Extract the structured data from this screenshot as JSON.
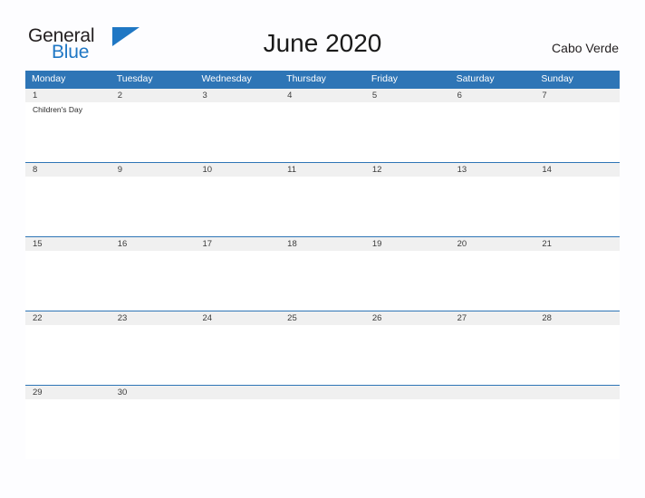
{
  "brand": {
    "name_part1": "General",
    "name_part2": "Blue",
    "flag_icon": "blue-triangle-flag-icon",
    "color_dark": "#231f20",
    "color_blue": "#1f77c4"
  },
  "header": {
    "title": "June 2020",
    "region": "Cabo Verde"
  },
  "calendar": {
    "accent_color": "#2e75b6",
    "band_color": "#f0f0f0",
    "weekdays": [
      "Monday",
      "Tuesday",
      "Wednesday",
      "Thursday",
      "Friday",
      "Saturday",
      "Sunday"
    ],
    "weeks": [
      {
        "days": [
          {
            "date": "1",
            "event": "Children's Day"
          },
          {
            "date": "2",
            "event": ""
          },
          {
            "date": "3",
            "event": ""
          },
          {
            "date": "4",
            "event": ""
          },
          {
            "date": "5",
            "event": ""
          },
          {
            "date": "6",
            "event": ""
          },
          {
            "date": "7",
            "event": ""
          }
        ]
      },
      {
        "days": [
          {
            "date": "8",
            "event": ""
          },
          {
            "date": "9",
            "event": ""
          },
          {
            "date": "10",
            "event": ""
          },
          {
            "date": "11",
            "event": ""
          },
          {
            "date": "12",
            "event": ""
          },
          {
            "date": "13",
            "event": ""
          },
          {
            "date": "14",
            "event": ""
          }
        ]
      },
      {
        "days": [
          {
            "date": "15",
            "event": ""
          },
          {
            "date": "16",
            "event": ""
          },
          {
            "date": "17",
            "event": ""
          },
          {
            "date": "18",
            "event": ""
          },
          {
            "date": "19",
            "event": ""
          },
          {
            "date": "20",
            "event": ""
          },
          {
            "date": "21",
            "event": ""
          }
        ]
      },
      {
        "days": [
          {
            "date": "22",
            "event": ""
          },
          {
            "date": "23",
            "event": ""
          },
          {
            "date": "24",
            "event": ""
          },
          {
            "date": "25",
            "event": ""
          },
          {
            "date": "26",
            "event": ""
          },
          {
            "date": "27",
            "event": ""
          },
          {
            "date": "28",
            "event": ""
          }
        ]
      },
      {
        "days": [
          {
            "date": "29",
            "event": ""
          },
          {
            "date": "30",
            "event": ""
          },
          {
            "date": "",
            "event": ""
          },
          {
            "date": "",
            "event": ""
          },
          {
            "date": "",
            "event": ""
          },
          {
            "date": "",
            "event": ""
          },
          {
            "date": "",
            "event": ""
          }
        ]
      }
    ]
  }
}
